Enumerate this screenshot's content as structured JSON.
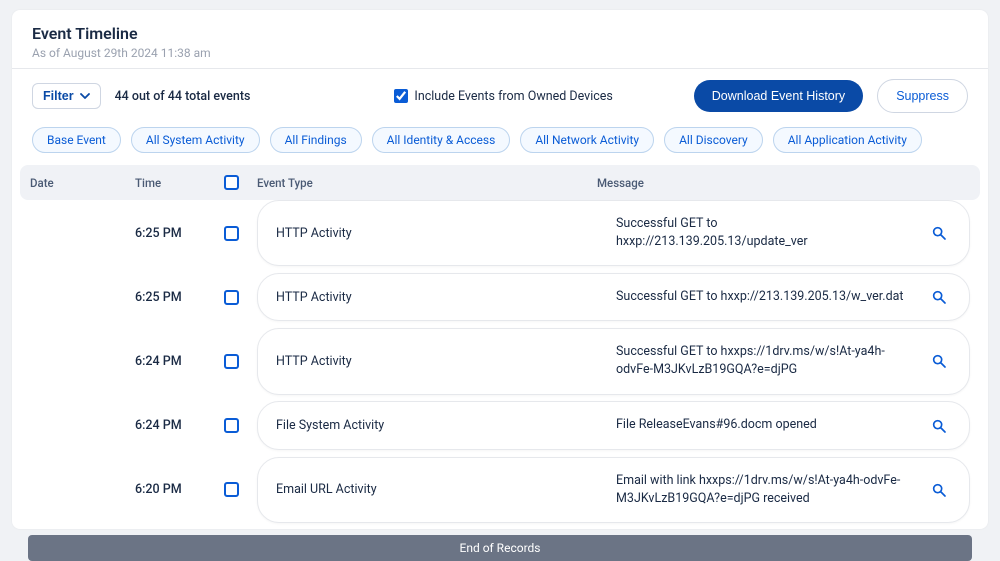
{
  "header": {
    "title": "Event Timeline",
    "subtitle": "As of August 29th 2024 11:38 am"
  },
  "controls": {
    "filter_label": "Filter",
    "count_text": "44 out of 44 total events",
    "include_label": "Include Events from Owned Devices",
    "include_checked": true,
    "download_label": "Download Event History",
    "suppress_label": "Suppress"
  },
  "chips": [
    "Base Event",
    "All System Activity",
    "All Findings",
    "All Identity & Access",
    "All Network Activity",
    "All Discovery",
    "All Application Activity"
  ],
  "columns": {
    "date": "Date",
    "time": "Time",
    "event_type": "Event Type",
    "message": "Message"
  },
  "rows": [
    {
      "time": "6:25 PM",
      "event_type": "HTTP Activity",
      "message": "Successful GET to hxxp://213.139.205.13/update_ver"
    },
    {
      "time": "6:25 PM",
      "event_type": "HTTP Activity",
      "message": "Successful GET to hxxp://213.139.205.13/w_ver.dat"
    },
    {
      "time": "6:24 PM",
      "event_type": "HTTP Activity",
      "message": "Successful GET to hxxps://1drv.ms/w/s!At-ya4h-odvFe-M3JKvLzB19GQA?e=djPG"
    },
    {
      "time": "6:24 PM",
      "event_type": "File System Activity",
      "message": "File ReleaseEvans#96.docm opened"
    },
    {
      "time": "6:20 PM",
      "event_type": "Email URL Activity",
      "message": "Email with link hxxps://1drv.ms/w/s!At-ya4h-odvFe-M3JKvLzB19GQA?e=djPG received"
    }
  ],
  "footer": {
    "end_label": "End of Records"
  }
}
